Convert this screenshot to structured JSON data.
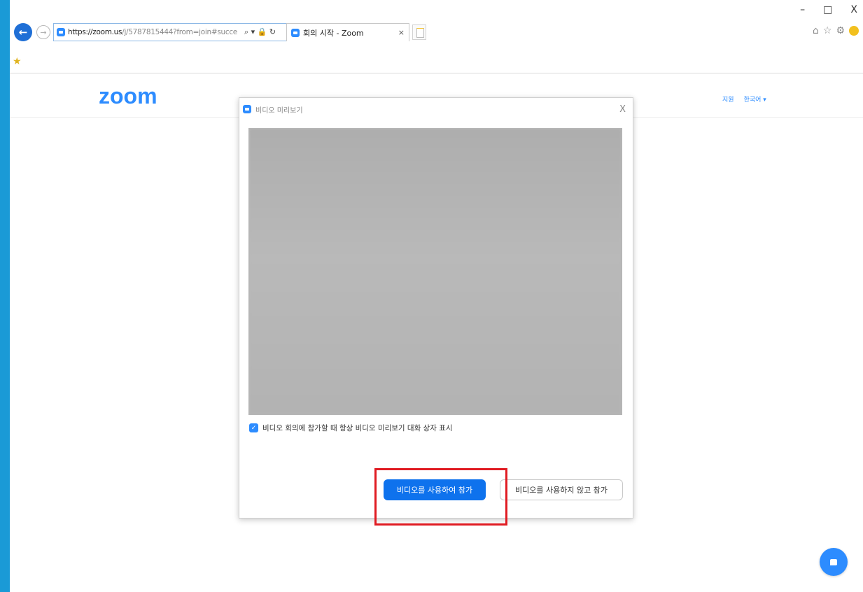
{
  "browser": {
    "url_host": "https://zoom.us",
    "url_rest": "/j/5787815444?from=join#succe",
    "address_icons": "⌕ ▾ 🔒 ↻",
    "tab_title": "회의 시작 - Zoom",
    "tab_close": "×",
    "window_controls": {
      "minimize": "–",
      "maximize": "□",
      "close": "X"
    },
    "back_glyph": "←",
    "forward_glyph": "→"
  },
  "zoom_header": {
    "logo": "zoom",
    "links": [
      "지원",
      "한국어 ▾"
    ]
  },
  "dialog": {
    "title": "비디오 미리보기",
    "close": "X",
    "checkbox_checked": true,
    "checkbox_label": "비디오 회의에 참가할 때 항상 비디오 미리보기 대화 상자 표시",
    "primary_button": "비디오를 사용하여 참가",
    "secondary_button": "비디오를 사용하지 않고 참가"
  },
  "colors": {
    "brand_blue": "#2d8cff",
    "primary_button": "#0e72ed",
    "highlight_red": "#e01b22",
    "desktop_background": "#1a9ad6"
  },
  "icons": [
    "back-icon",
    "forward-icon",
    "zoom-favicon",
    "search-icon",
    "lock-icon",
    "refresh-icon",
    "home-icon",
    "star-icon",
    "gear-icon",
    "smiley-icon",
    "favorites-star-icon",
    "chat-icon",
    "checkmark-icon",
    "close-icon"
  ]
}
